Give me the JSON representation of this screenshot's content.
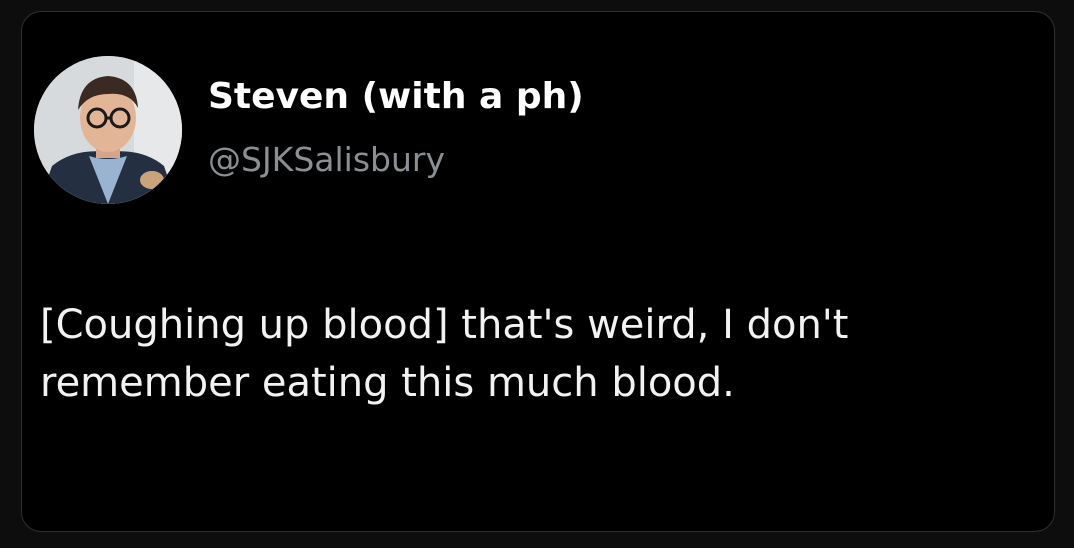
{
  "tweet": {
    "display_name": "Steven (with a ph)",
    "handle": "@SJKSalisbury",
    "text_lines": [
      "[Coughing up blood] that's weird, I don't",
      "remember eating this much blood."
    ],
    "avatar_icon": "profile-photo"
  },
  "colors": {
    "background": "#000000",
    "text": "#f2f2f2",
    "handle": "#8b8f94"
  }
}
